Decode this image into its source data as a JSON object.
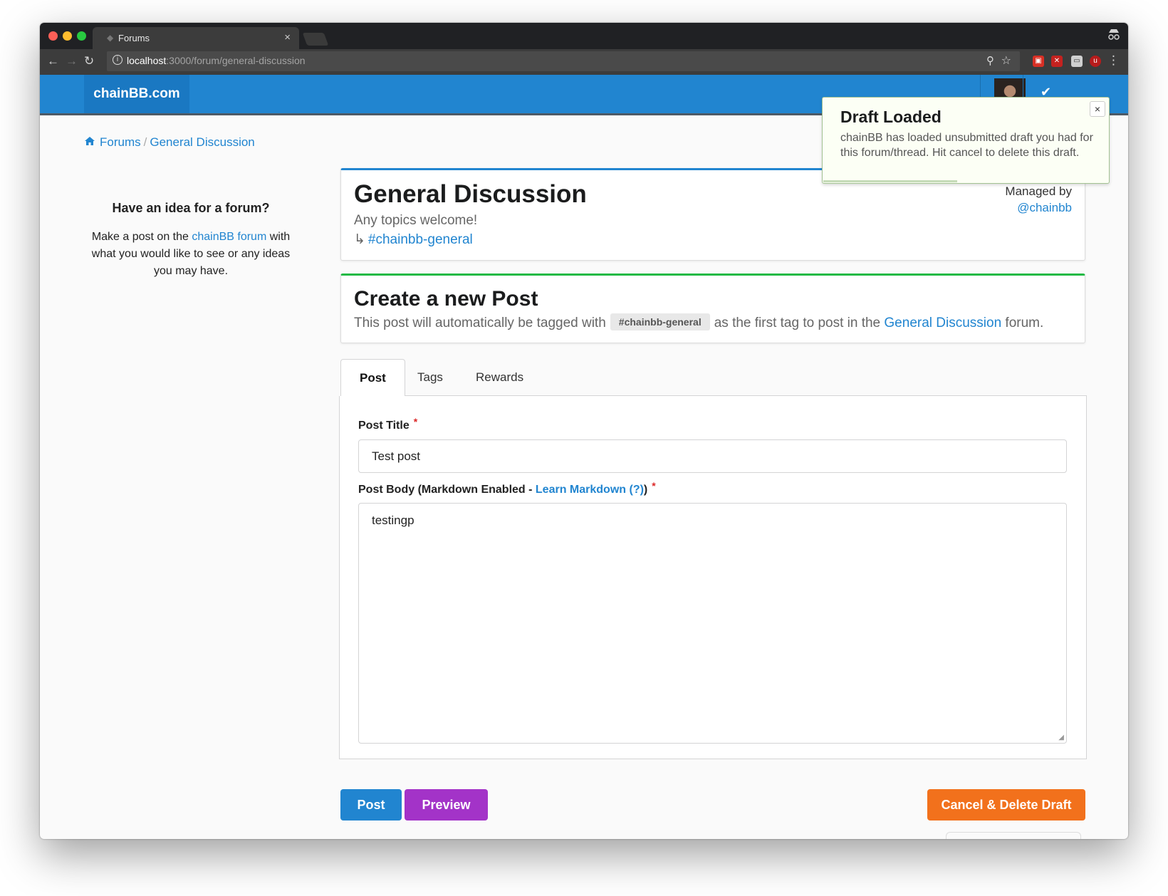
{
  "browser": {
    "tab_title": "Forums",
    "tab_close": "×",
    "url_host": "localhost",
    "url_path": ":3000/forum/general-discussion",
    "icons": [
      "back-icon",
      "forward-icon",
      "reload-icon",
      "info-icon",
      "zoom-icon",
      "star-icon",
      "incognito-icon"
    ]
  },
  "navbar": {
    "brand": "chainBB.com",
    "check": "✔",
    "color": "#2185d0"
  },
  "breadcrumb": {
    "forums": "Forums",
    "separator": "/",
    "current": "General Discussion"
  },
  "sidebar": {
    "heading": "Have an idea for a forum?",
    "text_before": "Make a post on the ",
    "link": "chainBB forum",
    "text_after": " with what you would like to see or any ideas you may have."
  },
  "forum": {
    "title": "General Discussion",
    "description": "Any topics welcome!",
    "arrow": "↳",
    "tag": "#chainbb-general",
    "managed_label": "Managed by",
    "managed_user": "@chainbb"
  },
  "create": {
    "title": "Create a new Post",
    "desc_before": "This post will automatically be tagged with",
    "tag_chip": "#chainbb-general",
    "desc_middle": "as the first tag to post in the ",
    "forum_link": "General Discussion",
    "desc_after": " forum."
  },
  "tabs": [
    {
      "label": "Post",
      "active": true
    },
    {
      "label": "Tags",
      "active": false
    },
    {
      "label": "Rewards",
      "active": false
    }
  ],
  "form": {
    "title_label": "Post Title",
    "required_mark": "*",
    "title_value": "Test post",
    "body_label_before": "Post Body (Markdown Enabled - ",
    "body_label_link": "Learn Markdown (?)",
    "body_label_after": ")",
    "body_value": "testingp"
  },
  "buttons": {
    "post": "Post",
    "preview": "Preview",
    "cancel": "Cancel & Delete Draft"
  },
  "toast": {
    "title": "Draft Loaded",
    "body": "chainBB has loaded unsubmitted draft you had for this forum/thread. Hit cancel to delete this draft.",
    "close": "×"
  },
  "colors": {
    "primary": "#2185d0",
    "success": "#21ba45",
    "purple": "#a333c8",
    "orange": "#f2711c",
    "required": "#db2828"
  }
}
